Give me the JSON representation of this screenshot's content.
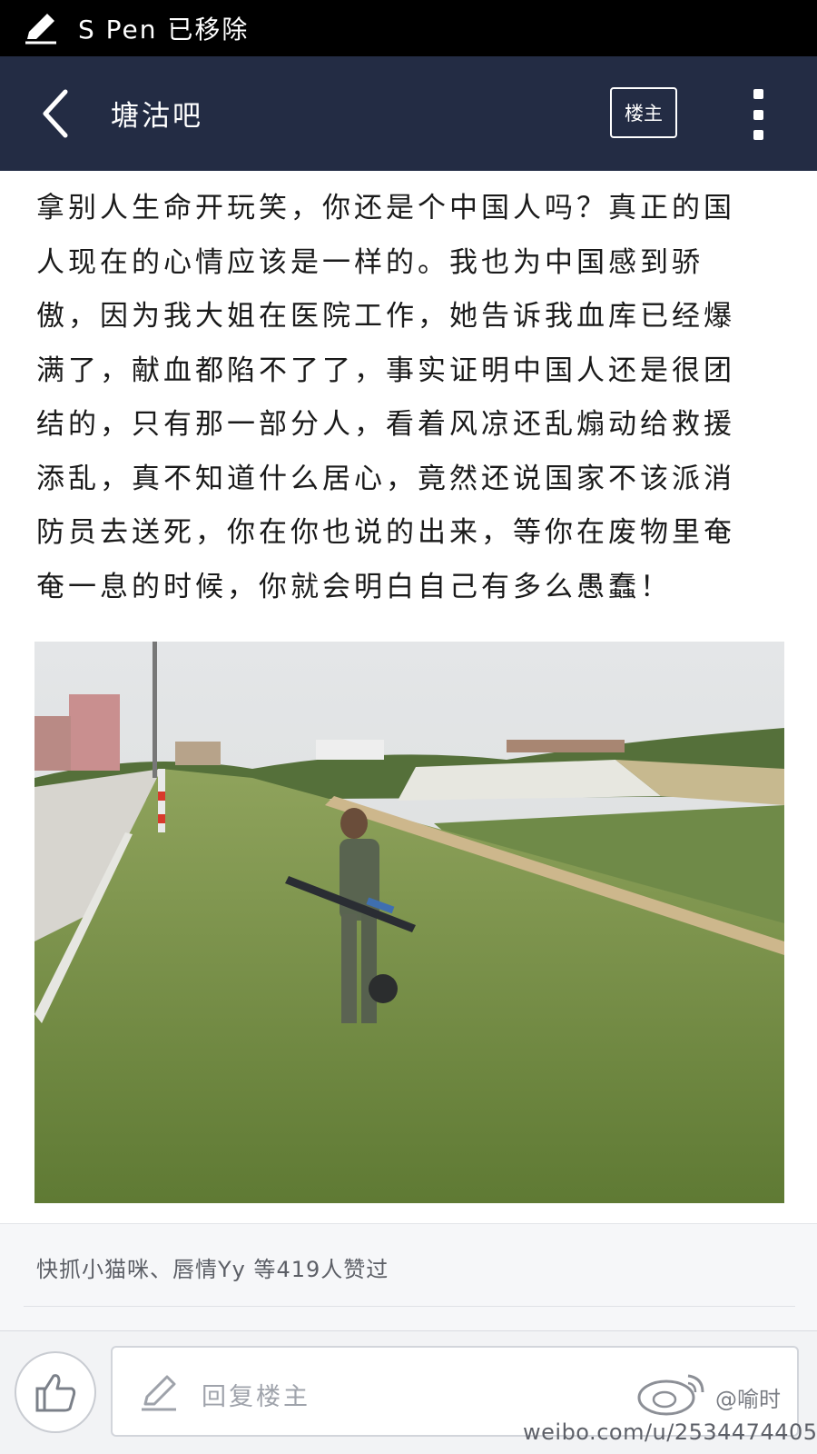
{
  "status_bar": {
    "text": "S Pen 已移除"
  },
  "nav": {
    "title": "塘沽吧",
    "owner_label": "楼主"
  },
  "post": {
    "lines": [
      "拿别人生命开玩笑，你还是个中国人吗？真正的国",
      "人现在的心情应该是一样的。我也为中国感到骄",
      "傲，因为我大姐在医院工作，她告诉我血库已经爆",
      "满了，献血都陷不了了，事实证明中国人还是很团",
      "结的，只有那一部分人，看着风凉还乱煽动给救援",
      "添乱，真不知道什么居心，竟然还说国家不该派消",
      "防员去送死，你在你也说的出来，等你在废物里奄",
      "奄一息的时候，你就会明白自己有多么愚蠢！"
    ]
  },
  "likes": {
    "text": "快抓小猫咪、唇情Yy 等419人赞过"
  },
  "reply": {
    "placeholder": "回复楼主"
  },
  "watermark": {
    "handle": "@喻时",
    "url": "weibo.com/u/2534474405"
  },
  "colors": {
    "status_bar_bg": "#000000",
    "nav_bg": "#232c44",
    "text": "#1a1a1a",
    "likes_bg": "#f6f7f9",
    "reply_bar_bg": "#f2f3f5"
  },
  "icons": {
    "status": "pen-icon",
    "back": "chevron-left-icon",
    "more": "more-vertical-icon",
    "like": "thumbs-up-icon",
    "reply": "pencil-icon",
    "watermark": "weibo-logo-icon"
  }
}
